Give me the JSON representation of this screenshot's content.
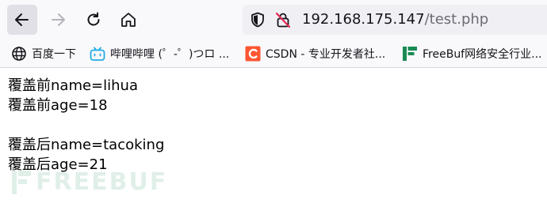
{
  "toolbar": {
    "address": {
      "host": "192.168.175.147",
      "path": "/test.php"
    }
  },
  "bookmarks": [
    {
      "label": "百度一下",
      "icon": "globe-icon"
    },
    {
      "label": "哔哩哔哩 (゜-゜)つロ ...",
      "icon": "bilibili-icon"
    },
    {
      "label": "CSDN - 专业开发者社...",
      "icon": "csdn-icon"
    },
    {
      "label": "FreeBuf网络安全行业...",
      "icon": "freebuf-icon"
    }
  ],
  "content": {
    "lines": [
      "覆盖前name=lihua",
      "覆盖前age=18",
      "",
      "覆盖后name=tacoking",
      "覆盖后age=21"
    ]
  },
  "watermark": {
    "text": "FREEBUF"
  },
  "colors": {
    "csdn": "#fc5531",
    "freebuf": "#1a8a55",
    "bilibili": "#23ade5"
  }
}
